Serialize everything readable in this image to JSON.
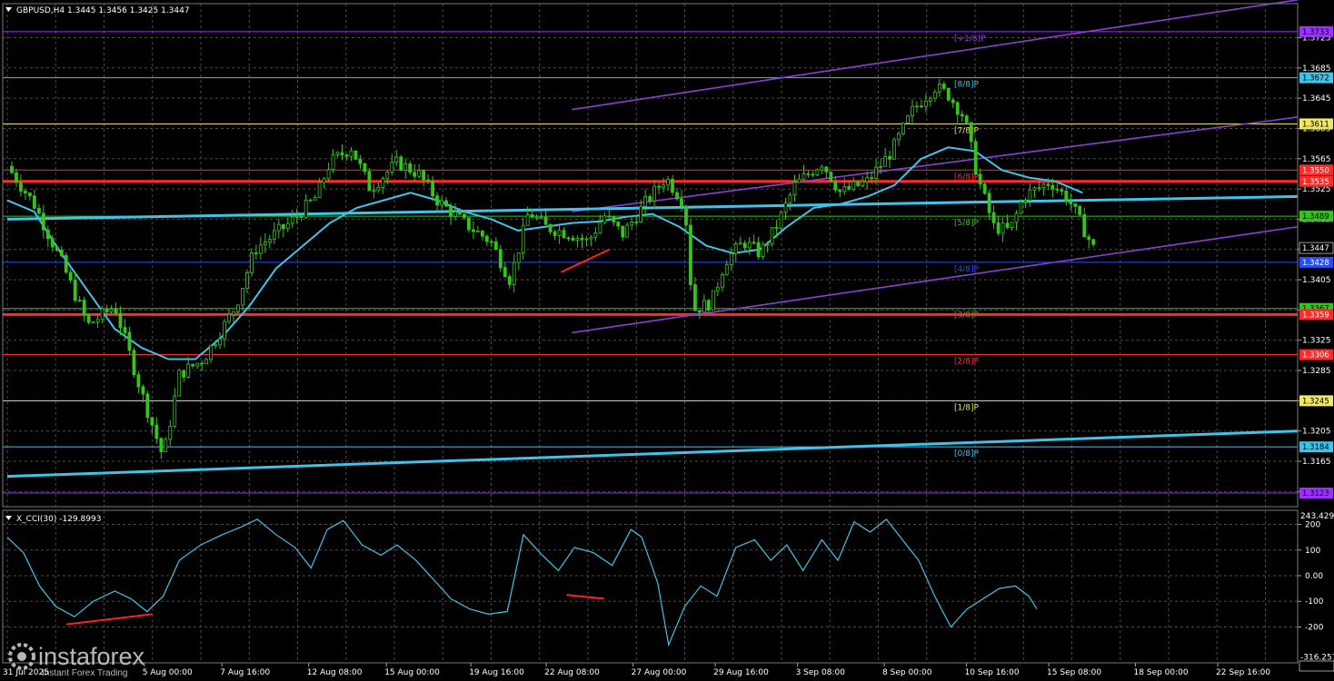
{
  "header": {
    "symbol_line": "GBPUSD,H4  1.3445 1.3456 1.3425 1.3447",
    "indicator_line": "X_CCI(30) -129.8993"
  },
  "watermark": {
    "brand": "instaforex",
    "tagline": "Instant Forex Trading",
    "date_fragment": "31 Jul 2025"
  },
  "colors": {
    "background": "#000000",
    "grid": "#4a4a4a",
    "candle": "#35c41b",
    "moving_average": "#3fc3e8",
    "trend_channel": "#8a3fd6",
    "cci_line": "#3fc3e8",
    "divergence": "#ff2020"
  },
  "murrey_levels": [
    {
      "price": 1.3733,
      "label": "[+1/8]P",
      "line_color": "#9b30ff",
      "badge_bg": "#9b30ff",
      "badge_text": "#000000",
      "thick": false
    },
    {
      "price": 1.3672,
      "label": "[8/8]P",
      "line_color": "#3fc3e8",
      "badge_bg": "#3fc3e8",
      "badge_text": "#000000",
      "thick": false
    },
    {
      "price": 1.3611,
      "label": "[7/8]P",
      "line_color": "#e8e84a",
      "badge_bg": "#f0e860",
      "badge_text": "#000000",
      "thick": false
    },
    {
      "price": 1.355,
      "label": "[6/8]P",
      "line_color": "#ff2a2a",
      "badge_bg": "#ff2a2a",
      "badge_text": "#ffffff",
      "thick": false
    },
    {
      "price": 1.3535,
      "label": "",
      "line_color": "#ff2a2a",
      "badge_bg": "#ff2a2a",
      "badge_text": "#ffffff",
      "thick": true
    },
    {
      "price": 1.3489,
      "label": "[5/8]P",
      "line_color": "#35c41b",
      "badge_bg": "#35c41b",
      "badge_text": "#000000",
      "thick": false
    },
    {
      "price": 1.3428,
      "label": "[4/8]P",
      "line_color": "#2a4cff",
      "badge_bg": "#2a4cff",
      "badge_text": "#ffffff",
      "thick": false
    },
    {
      "price": 1.3367,
      "label": "[3/8]P",
      "line_color": "#35c41b",
      "badge_bg": "#35c41b",
      "badge_text": "#000000",
      "thick": false
    },
    {
      "price": 1.3359,
      "label": "",
      "line_color": "#ff2a2a",
      "badge_bg": "#ff2a2a",
      "badge_text": "#ffffff",
      "thick": true
    },
    {
      "price": 1.3306,
      "label": "[2/8]P",
      "line_color": "#ff2a2a",
      "badge_bg": "#ff2a2a",
      "badge_text": "#ffffff",
      "thick": false
    },
    {
      "price": 1.3245,
      "label": "[1/8]P",
      "line_color": "#e8e84a",
      "badge_bg": "#f0e860",
      "badge_text": "#000000",
      "thick": false
    },
    {
      "price": 1.3184,
      "label": "[0/8]P",
      "line_color": "#3fc3e8",
      "badge_bg": "#3fc3e8",
      "badge_text": "#000000",
      "thick": false
    },
    {
      "price": 1.3123,
      "label": "",
      "line_color": "#9b30ff",
      "badge_bg": "#9b30ff",
      "badge_text": "#000000",
      "thick": false
    }
  ],
  "current_price": {
    "value": 1.3447,
    "label": "1.3447"
  },
  "chart_data": [
    {
      "type": "candlestick",
      "title": "GBPUSD,H4",
      "grid": true,
      "ylim": [
        1.3105,
        1.377
      ],
      "y_ticks": [
        1.3725,
        1.3685,
        1.3645,
        1.3605,
        1.3565,
        1.3525,
        1.3485,
        1.3445,
        1.3405,
        1.3365,
        1.3325,
        1.3285,
        1.3245,
        1.3205,
        1.3165,
        1.3125
      ],
      "y_tick_labels": [
        "1.3725",
        "1.3685",
        "1.3645",
        "1.3605",
        "1.3565",
        "1.3525",
        "1.3485",
        "1.3445",
        "1.3405",
        "1.3365",
        "1.3325",
        "1.3285",
        "1.3245",
        "1.3205",
        "1.3165",
        "1.3125"
      ],
      "x_labels": [
        "5 Aug 00:00",
        "7 Aug 16:00",
        "12 Aug 08:00",
        "15 Aug 00:00",
        "19 Aug 16:00",
        "22 Aug 08:00",
        "27 Aug 00:00",
        "29 Aug 16:00",
        "3 Sep 08:00",
        "8 Sep 00:00",
        "10 Sep 16:00",
        "15 Sep 08:00",
        "18 Sep 00:00",
        "22 Sep 16:00"
      ],
      "x_range": [
        0,
        48
      ],
      "x_label_positions": [
        6.0,
        9.4,
        13.2,
        16.6,
        20.3,
        23.6,
        27.4,
        31.0,
        34.6,
        38.4,
        42.0,
        45.6,
        49.4,
        53.0
      ],
      "price_path": [
        [
          0,
          1.3555
        ],
        [
          1,
          1.3505
        ],
        [
          2,
          1.343
        ],
        [
          3,
          1.3345
        ],
        [
          4,
          1.337
        ],
        [
          5,
          1.3255
        ],
        [
          5.8,
          1.317
        ],
        [
          6.4,
          1.328
        ],
        [
          7.3,
          1.33
        ],
        [
          8.5,
          1.337
        ],
        [
          9.2,
          1.3445
        ],
        [
          10.5,
          1.348
        ],
        [
          11.5,
          1.3515
        ],
        [
          12,
          1.356
        ],
        [
          12.8,
          1.358
        ],
        [
          13.5,
          1.3525
        ],
        [
          14.5,
          1.356
        ],
        [
          15.3,
          1.3545
        ],
        [
          16,
          1.351
        ],
        [
          17,
          1.348
        ],
        [
          18,
          1.3455
        ],
        [
          18.7,
          1.3405
        ],
        [
          19.4,
          1.3495
        ],
        [
          20,
          1.3475
        ],
        [
          21,
          1.3465
        ],
        [
          21.6,
          1.3455
        ],
        [
          22.2,
          1.349
        ],
        [
          22.9,
          1.3465
        ],
        [
          23.7,
          1.3505
        ],
        [
          24.5,
          1.354
        ],
        [
          25.2,
          1.3505
        ],
        [
          25.5,
          1.3365
        ],
        [
          26.2,
          1.3375
        ],
        [
          26.7,
          1.343
        ],
        [
          27.4,
          1.3455
        ],
        [
          28,
          1.344
        ],
        [
          28.6,
          1.3475
        ],
        [
          29.3,
          1.353
        ],
        [
          30.3,
          1.356
        ],
        [
          31,
          1.352
        ],
        [
          32,
          1.3535
        ],
        [
          32.9,
          1.3575
        ],
        [
          33.7,
          1.363
        ],
        [
          34.5,
          1.366
        ],
        [
          35,
          1.365
        ],
        [
          35.6,
          1.362
        ],
        [
          36.1,
          1.354
        ],
        [
          36.7,
          1.3475
        ],
        [
          37.3,
          1.347
        ],
        [
          37.8,
          1.3515
        ],
        [
          38.8,
          1.3535
        ],
        [
          39.5,
          1.351
        ],
        [
          40.4,
          1.3447
        ]
      ],
      "moving_average": [
        [
          0,
          1.351
        ],
        [
          1,
          1.3495
        ],
        [
          2,
          1.344
        ],
        [
          3,
          1.339
        ],
        [
          4,
          1.334
        ],
        [
          5,
          1.3315
        ],
        [
          6,
          1.33
        ],
        [
          7,
          1.33
        ],
        [
          8,
          1.333
        ],
        [
          9,
          1.337
        ],
        [
          10,
          1.342
        ],
        [
          11,
          1.345
        ],
        [
          12,
          1.348
        ],
        [
          13,
          1.35
        ],
        [
          14,
          1.351
        ],
        [
          15,
          1.352
        ],
        [
          16,
          1.351
        ],
        [
          17,
          1.3495
        ],
        [
          18,
          1.3485
        ],
        [
          19,
          1.347
        ],
        [
          20,
          1.3475
        ],
        [
          21,
          1.348
        ],
        [
          22,
          1.3482
        ],
        [
          23,
          1.3488
        ],
        [
          24,
          1.3492
        ],
        [
          25,
          1.3475
        ],
        [
          26,
          1.345
        ],
        [
          27,
          1.344
        ],
        [
          28,
          1.3445
        ],
        [
          29,
          1.3475
        ],
        [
          30,
          1.35
        ],
        [
          31,
          1.3505
        ],
        [
          32,
          1.3515
        ],
        [
          33,
          1.353
        ],
        [
          34,
          1.3565
        ],
        [
          35,
          1.358
        ],
        [
          36,
          1.3575
        ],
        [
          37,
          1.355
        ],
        [
          38,
          1.354
        ],
        [
          39,
          1.3535
        ],
        [
          40,
          1.352
        ]
      ],
      "trend_lines": [
        {
          "name": "upper",
          "points": [
            [
              21.0,
              1.363
            ],
            [
              48.0,
              1.3775
            ]
          ]
        },
        {
          "name": "middle",
          "points": [
            [
              21.0,
              1.3495
            ],
            [
              48.0,
              1.362
            ]
          ]
        },
        {
          "name": "lower",
          "points": [
            [
              21.0,
              1.3335
            ],
            [
              48.0,
              1.3475
            ]
          ]
        },
        {
          "name": "long-term-upper",
          "points": [
            [
              0,
              1.3485
            ],
            [
              48.0,
              1.3515
            ]
          ]
        },
        {
          "name": "long-term-lower",
          "points": [
            [
              0,
              1.3145
            ],
            [
              48.0,
              1.3205
            ]
          ]
        }
      ],
      "divergence": [
        [
          20.6,
          1.3415
        ],
        [
          22.4,
          1.3445
        ]
      ]
    },
    {
      "type": "line",
      "title": "X_CCI(30) -129.8993",
      "grid": true,
      "ylim": [
        -340,
        255
      ],
      "y_ticks": [
        200,
        100,
        0,
        -100,
        -200
      ],
      "y_tick_labels": [
        "200",
        "100",
        "0.00",
        "-100",
        "-200"
      ],
      "max_label": "243.429",
      "min_label": "-316.257",
      "values": [
        [
          0,
          150
        ],
        [
          0.6,
          90
        ],
        [
          1.2,
          -40
        ],
        [
          1.8,
          -120
        ],
        [
          2.5,
          -160
        ],
        [
          3.2,
          -100
        ],
        [
          4,
          -60
        ],
        [
          4.6,
          -90
        ],
        [
          5.2,
          -140
        ],
        [
          5.8,
          -80
        ],
        [
          6.4,
          60
        ],
        [
          7.2,
          120
        ],
        [
          8,
          160
        ],
        [
          8.7,
          190
        ],
        [
          9.3,
          220
        ],
        [
          10,
          160
        ],
        [
          10.7,
          110
        ],
        [
          11.3,
          30
        ],
        [
          11.9,
          180
        ],
        [
          12.5,
          215
        ],
        [
          13.2,
          120
        ],
        [
          13.9,
          80
        ],
        [
          14.5,
          120
        ],
        [
          15.2,
          60
        ],
        [
          15.9,
          -20
        ],
        [
          16.5,
          -90
        ],
        [
          17.2,
          -130
        ],
        [
          17.9,
          -150
        ],
        [
          18.6,
          -140
        ],
        [
          19.2,
          160
        ],
        [
          19.9,
          80
        ],
        [
          20.5,
          20
        ],
        [
          21.1,
          110
        ],
        [
          21.8,
          90
        ],
        [
          22.5,
          40
        ],
        [
          23.2,
          180
        ],
        [
          23.6,
          150
        ],
        [
          24.2,
          -30
        ],
        [
          24.6,
          -270
        ],
        [
          25.2,
          -120
        ],
        [
          25.8,
          -40
        ],
        [
          26.4,
          -80
        ],
        [
          27.1,
          110
        ],
        [
          27.8,
          140
        ],
        [
          28.4,
          60
        ],
        [
          29,
          120
        ],
        [
          29.6,
          20
        ],
        [
          30.3,
          140
        ],
        [
          30.9,
          60
        ],
        [
          31.5,
          210
        ],
        [
          32.1,
          170
        ],
        [
          32.7,
          220
        ],
        [
          33.3,
          140
        ],
        [
          33.9,
          60
        ],
        [
          34.5,
          -80
        ],
        [
          35.1,
          -200
        ],
        [
          35.7,
          -130
        ],
        [
          36.3,
          -90
        ],
        [
          36.9,
          -50
        ],
        [
          37.5,
          -40
        ],
        [
          38,
          -80
        ],
        [
          38.3,
          -129.9
        ]
      ],
      "divergences": [
        [
          [
            2.2,
            -190
          ],
          [
            5.4,
            -150
          ]
        ],
        [
          [
            20.8,
            -75
          ],
          [
            22.2,
            -90
          ]
        ]
      ]
    }
  ]
}
